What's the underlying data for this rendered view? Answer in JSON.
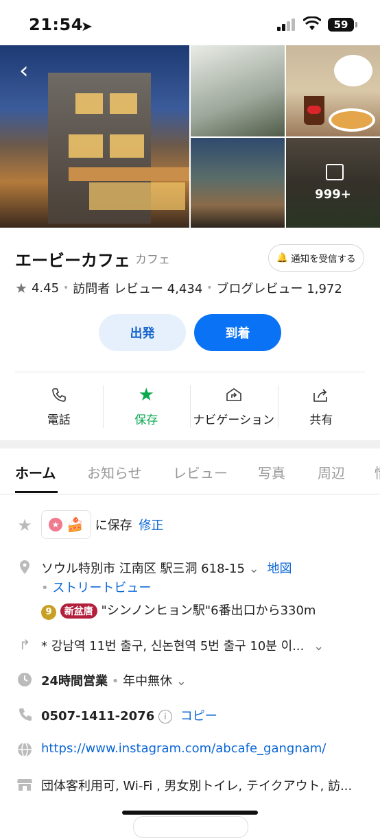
{
  "status_bar": {
    "time": "21:54",
    "battery": "59"
  },
  "gallery": {
    "more_count": "999+"
  },
  "place": {
    "name": "エービーカフェ",
    "category": "カフェ",
    "notify_label": "通知を受信する",
    "rating": "4.45",
    "visitor_reviews_label": "訪問者 レビュー",
    "visitor_reviews_count": "4,434",
    "blog_reviews_label": "ブログレビュー",
    "blog_reviews_count": "1,972"
  },
  "route": {
    "depart": "出発",
    "arrive": "到着"
  },
  "actions": [
    {
      "label": "電話",
      "icon": "phone-icon"
    },
    {
      "label": "保存",
      "icon": "star-icon",
      "color": "#09a94f"
    },
    {
      "label": "ナビゲーション",
      "icon": "navigation-icon"
    },
    {
      "label": "共有",
      "icon": "share-icon"
    }
  ],
  "tabs": [
    "ホーム",
    "お知らせ",
    "レビュー",
    "写真",
    "周辺",
    "情"
  ],
  "details": {
    "saved_text": "に保存",
    "edit_label": "修正",
    "address": "ソウル特別市 江南区 駅三洞 618-15",
    "map_label": "地図",
    "street_view_label": "ストリートビュー",
    "line_number": "9",
    "line_name": "新盆唐",
    "station_directions": "\"シンノンヒョン駅\"6番出口から330m",
    "directions": "* 강남역 11번 출구, 신논현역 5번 출구 10분 이...",
    "hours": "24時間営業",
    "hours_note": "年中無休",
    "phone": "0507-1411-2076",
    "copy_label": "コピー",
    "website": "https://www.instagram.com/abcafe_gangnam/",
    "amenities": "団体客利用可, Wi-Fi , 男女別トイレ, テイクアウト, 訪..."
  },
  "colors": {
    "accent": "#0a72f5",
    "save_green": "#09a94f",
    "link": "#0a66d6"
  }
}
